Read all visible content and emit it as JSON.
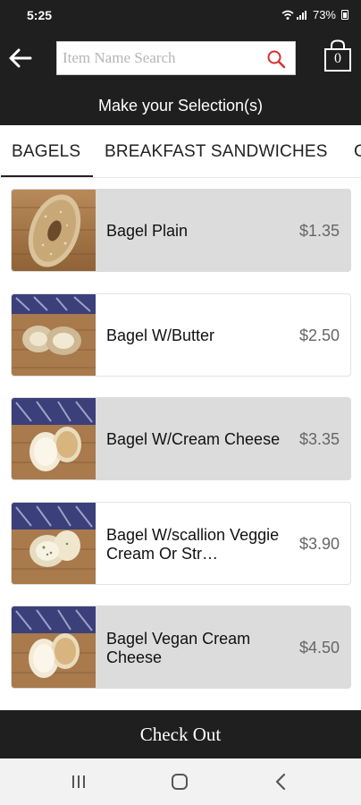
{
  "status": {
    "time": "5:25",
    "battery": "73%"
  },
  "header": {
    "search_placeholder": "Item Name Search",
    "cart_count": "0",
    "selection_title": "Make your Selection(s)"
  },
  "tabs": [
    {
      "label": "BAGELS",
      "active": true
    },
    {
      "label": "BREAKFAST SANDWICHES",
      "active": false
    },
    {
      "label": "C",
      "active": false
    }
  ],
  "items": [
    {
      "name": "Bagel Plain",
      "price": "$1.35",
      "image": "plain-bagel-photo"
    },
    {
      "name": "Bagel W/Butter",
      "price": "$2.50",
      "image": "bagel-butter-photo"
    },
    {
      "name": "Bagel W/Cream Cheese",
      "price": "$3.35",
      "image": "bagel-cream-cheese-photo"
    },
    {
      "name": "Bagel W/scallion Veggie Cream Or Str…",
      "price": "$3.90",
      "image": "bagel-scallion-photo"
    },
    {
      "name": "Bagel Vegan Cream Cheese",
      "price": "$4.50",
      "image": "bagel-vegan-photo"
    }
  ],
  "footer": {
    "checkout_label": "Check Out"
  },
  "colors": {
    "bar_background": "#1f1f1f",
    "shaded_item": "#dcdcdc",
    "search_icon": "#d32f2f"
  }
}
